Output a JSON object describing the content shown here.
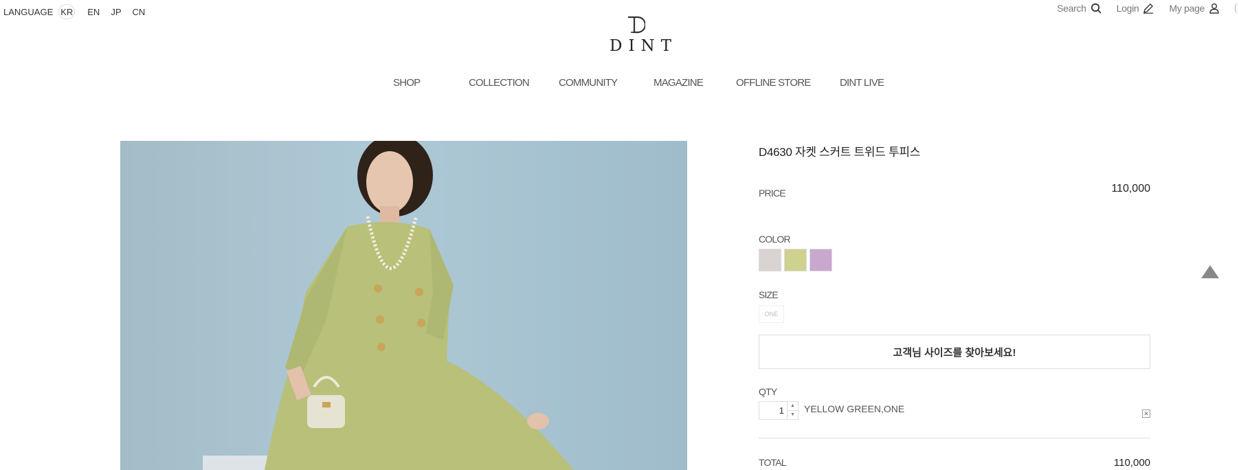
{
  "language": {
    "label": "LANGUAGE",
    "options": [
      "KR",
      "EN",
      "JP",
      "CN"
    ],
    "active": "KR"
  },
  "top_links": {
    "search": "Search",
    "login": "Login",
    "mypage": "My page"
  },
  "brand": {
    "name": "DINT"
  },
  "nav": [
    "SHOP",
    "COLLECTION",
    "COMMUNITY",
    "MAGAZINE",
    "OFFLINE STORE",
    "DINT LIVE"
  ],
  "product": {
    "title": "D4630 자켓 스커트 트위드 투피스",
    "price_label": "PRICE",
    "price": "110,000",
    "color_label": "COLOR",
    "colors": [
      "#d9d4d2",
      "#cfd28e",
      "#c9a8cf"
    ],
    "size_label": "SIZE",
    "size_option": "ONE",
    "find_size": "고객님 사이즈를 찾아보세요!",
    "qty_label": "QTY",
    "qty_value": "1",
    "selected_option": "YELLOW GREEN,ONE",
    "total_label": "TOTAL",
    "total": "110,000"
  }
}
